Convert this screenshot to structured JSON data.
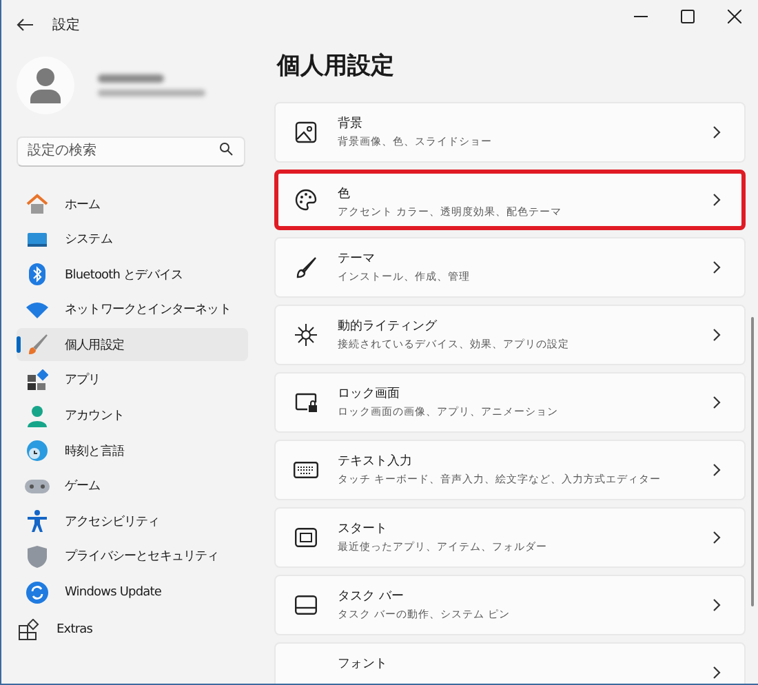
{
  "window": {
    "title": "設定"
  },
  "search": {
    "placeholder": "設定の検索"
  },
  "nav": [
    {
      "label": "ホーム",
      "selected": false
    },
    {
      "label": "システム",
      "selected": false
    },
    {
      "label": "Bluetooth とデバイス",
      "selected": false
    },
    {
      "label": "ネットワークとインターネット",
      "selected": false
    },
    {
      "label": "個人用設定",
      "selected": true
    },
    {
      "label": "アプリ",
      "selected": false
    },
    {
      "label": "アカウント",
      "selected": false
    },
    {
      "label": "時刻と言語",
      "selected": false
    },
    {
      "label": "ゲーム",
      "selected": false
    },
    {
      "label": "アクセシビリティ",
      "selected": false
    },
    {
      "label": "プライバシーとセキュリティ",
      "selected": false
    },
    {
      "label": "Windows Update",
      "selected": false
    },
    {
      "label": "Extras",
      "selected": false
    }
  ],
  "page_title": "個人用設定",
  "cards": [
    {
      "title": "背景",
      "subtitle": "背景画像、色、スライドショー",
      "highlighted": false
    },
    {
      "title": "色",
      "subtitle": "アクセント カラー、透明度効果、配色テーマ",
      "highlighted": true
    },
    {
      "title": "テーマ",
      "subtitle": "インストール、作成、管理",
      "highlighted": false
    },
    {
      "title": "動的ライティング",
      "subtitle": "接続されているデバイス、効果、アプリの設定",
      "highlighted": false
    },
    {
      "title": "ロック画面",
      "subtitle": "ロック画面の画像、アプリ、アニメーション",
      "highlighted": false
    },
    {
      "title": "テキスト入力",
      "subtitle": "タッチ キーボード、音声入力、絵文字など、入力方式エディター",
      "highlighted": false
    },
    {
      "title": "スタート",
      "subtitle": "最近使ったアプリ、アイテム、フォルダー",
      "highlighted": false
    },
    {
      "title": "タスク バー",
      "subtitle": "タスク バーの動作、システム ピン",
      "highlighted": false
    },
    {
      "title": "フォント",
      "highlighted": false
    }
  ]
}
